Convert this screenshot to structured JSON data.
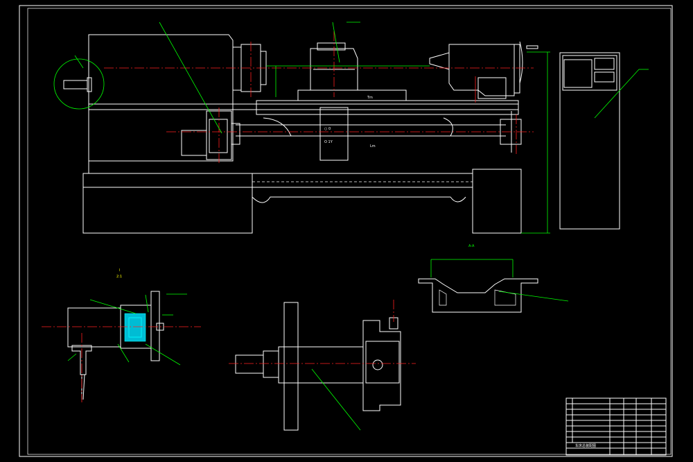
{
  "colors": {
    "background": "#000000",
    "outline": "#ffffff",
    "centerline": "#ff2020",
    "leader": "#00ff00",
    "section": "#00ffff",
    "text_yellow": "#ffff00"
  },
  "labels": {
    "carriage_mark_top": "○ 0",
    "carriage_mark_bottom": "O 1Y",
    "bed_label": "Lm",
    "rail_label": "Tm",
    "section_title": "A-A",
    "detail_title": "I",
    "detail_scale": "2:1",
    "title_block_name": "车床总装配图"
  },
  "title_block": {
    "rows": [
      "",
      "",
      "",
      "",
      "",
      "",
      "",
      "",
      ""
    ]
  }
}
